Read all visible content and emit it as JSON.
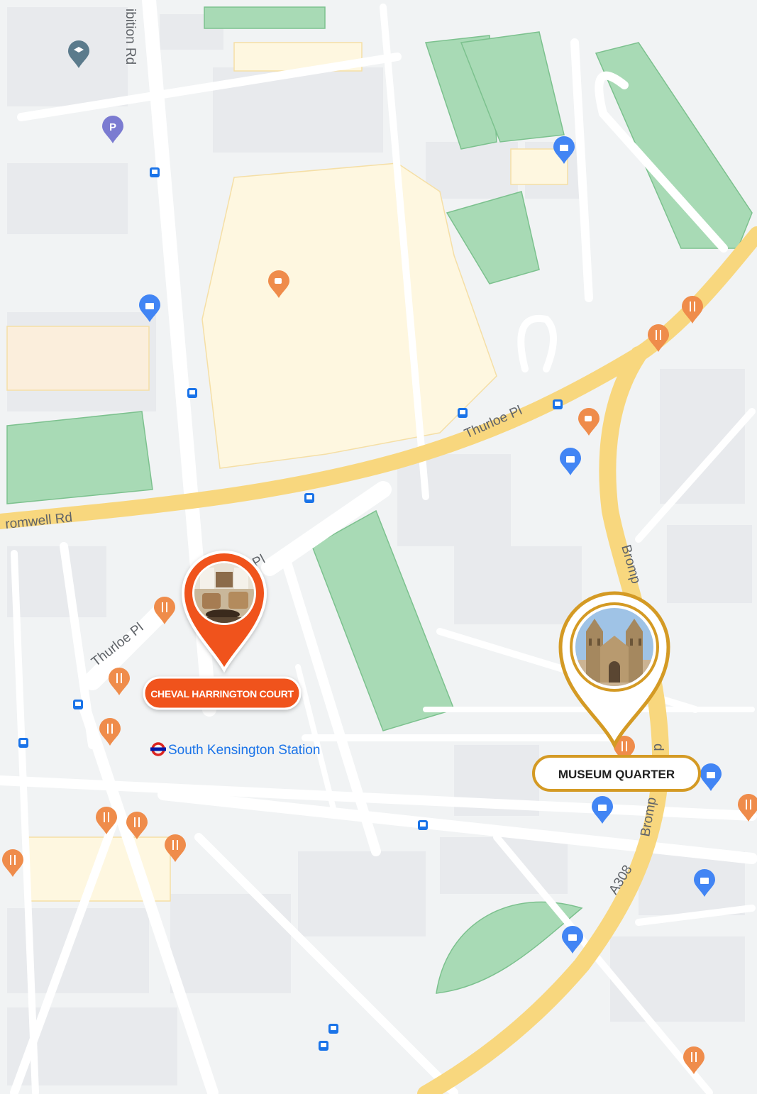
{
  "map": {
    "road_labels": {
      "exhibition_rd": "ibition Rd",
      "cromwell_rd": "romwell Rd",
      "thurloe_pl_east": "Thurloe Pl",
      "thurloe_pl_west": "Thurloe Pl",
      "thurloe_pl_short": "Pl",
      "brompton_rd_upper": "Bromp",
      "brompton_rd_mid": "d",
      "brompton_rd_lower": "Bromp",
      "a308": "A308"
    },
    "station_label": "South Kensington Station",
    "colors": {
      "base": "#f1f3f4",
      "block": "#e8eaed",
      "park": "#a8dab5",
      "major_road": "#f8d77e",
      "minor_road": "#ffffff",
      "venue": "#fef7e0",
      "poi_blue": "#4285f4",
      "poi_orange": "#ef8c4b",
      "poi_purple": "#7b7bd1",
      "poi_slate": "#5b7b8c",
      "transit": "#1a73e8",
      "underground_red": "#dc241f"
    }
  },
  "markers": [
    {
      "label": "CHEVAL HARRINGTON COURT",
      "color": "#f0521a",
      "photo": "interior-photo",
      "interactable": true
    },
    {
      "label": "MUSEUM QUARTER",
      "color": "#d49a24",
      "photo": "museum-photo",
      "interactable": true
    }
  ]
}
